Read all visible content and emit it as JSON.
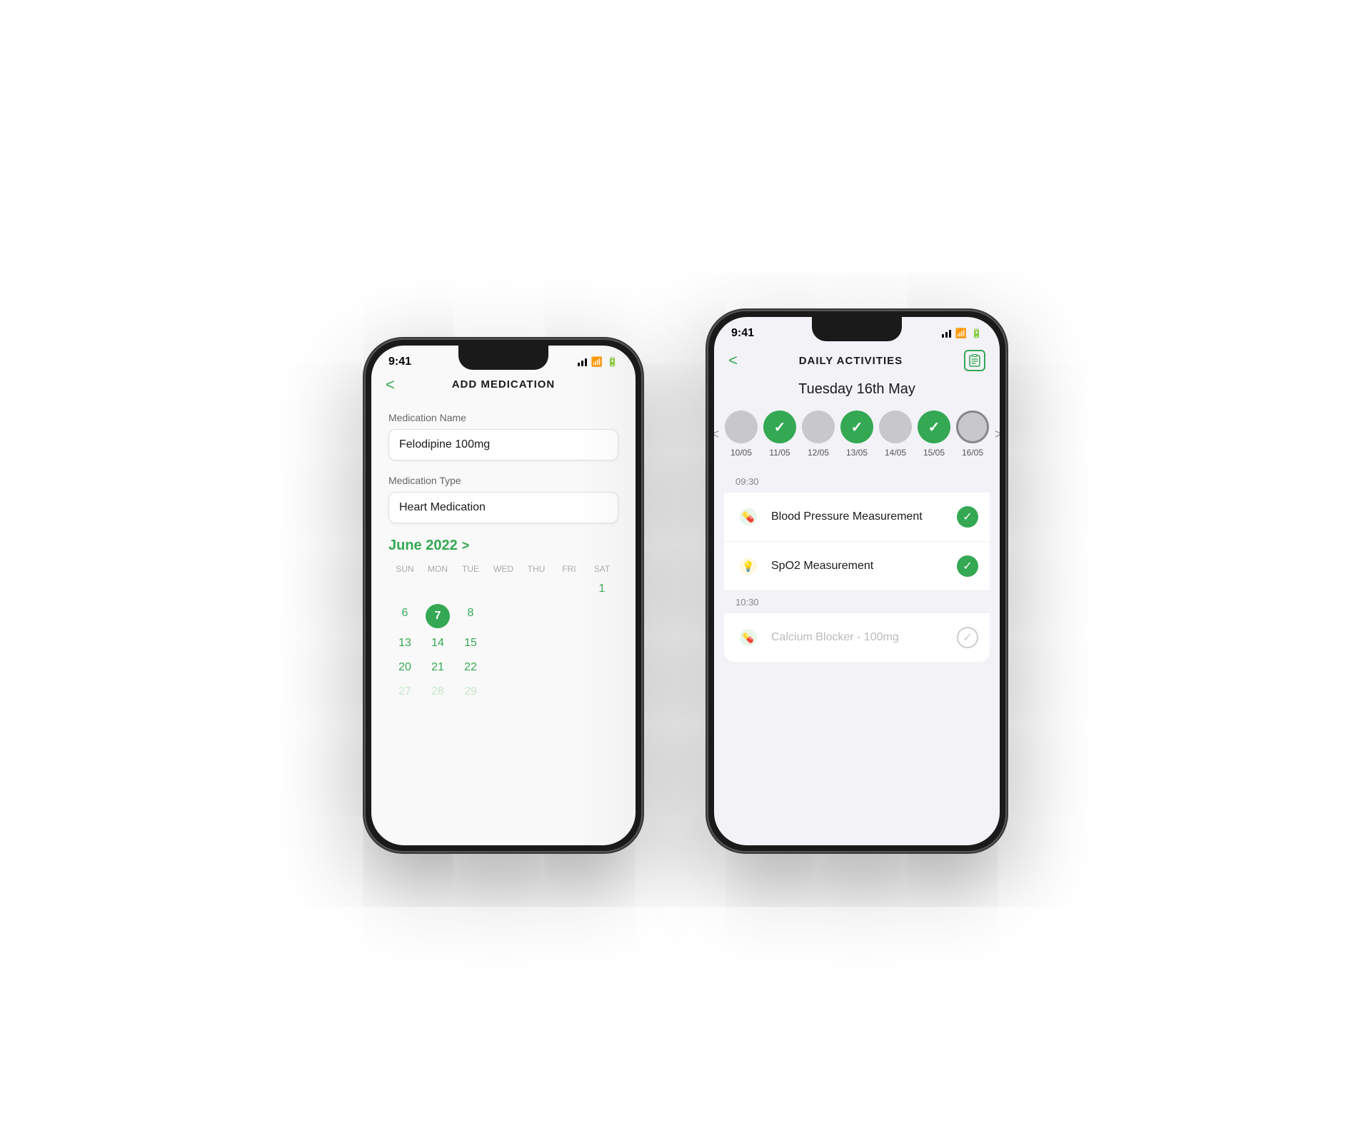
{
  "phone1": {
    "status": {
      "time": "9:41",
      "signal": [
        3,
        4,
        5
      ],
      "wifi": "wifi",
      "battery": "battery"
    },
    "nav": {
      "back": "<",
      "title": "ADD MEDICATION"
    },
    "form": {
      "name_label": "Medication Name",
      "name_value": "Felodipine 100mg",
      "type_label": "Medication Type",
      "type_value": "Heart Medication"
    },
    "calendar": {
      "month_label": "June 2022",
      "chevron": ">",
      "headers": [
        "SUN",
        "MON",
        "TUE",
        "WED",
        "THU",
        "FRI",
        "SAT"
      ],
      "days": [
        {
          "label": "",
          "state": "empty"
        },
        {
          "label": "",
          "state": "empty"
        },
        {
          "label": "",
          "state": "empty"
        },
        {
          "label": "",
          "state": "empty"
        },
        {
          "label": "",
          "state": "empty"
        },
        {
          "label": "",
          "state": "empty"
        },
        {
          "label": "1",
          "state": "normal"
        },
        {
          "label": "6",
          "state": "normal"
        },
        {
          "label": "7",
          "state": "today"
        },
        {
          "label": "8",
          "state": "normal"
        },
        {
          "label": "",
          "state": "empty"
        },
        {
          "label": "",
          "state": "empty"
        },
        {
          "label": "",
          "state": "empty"
        },
        {
          "label": "",
          "state": "empty"
        },
        {
          "label": "13",
          "state": "normal"
        },
        {
          "label": "14",
          "state": "normal"
        },
        {
          "label": "15",
          "state": "normal"
        },
        {
          "label": "",
          "state": "empty"
        },
        {
          "label": "",
          "state": "empty"
        },
        {
          "label": "",
          "state": "empty"
        },
        {
          "label": "",
          "state": "empty"
        },
        {
          "label": "20",
          "state": "normal"
        },
        {
          "label": "21",
          "state": "normal"
        },
        {
          "label": "22",
          "state": "normal"
        },
        {
          "label": "",
          "state": "empty"
        },
        {
          "label": "",
          "state": "empty"
        },
        {
          "label": "",
          "state": "empty"
        },
        {
          "label": "",
          "state": "empty"
        },
        {
          "label": "27",
          "state": "faded"
        },
        {
          "label": "28",
          "state": "faded"
        },
        {
          "label": "29",
          "state": "faded"
        }
      ]
    }
  },
  "phone2": {
    "status": {
      "time": "9:41",
      "signal": [
        3,
        4,
        5
      ],
      "wifi": "wifi",
      "battery": "battery"
    },
    "nav": {
      "back": "<",
      "title": "DAILY ACTIVITIES",
      "icon": "📋"
    },
    "date_title": "Tuesday 16th May",
    "day_strip": {
      "prev": "<",
      "next": ">",
      "days": [
        {
          "label": "10/05",
          "checked": false
        },
        {
          "label": "11/05",
          "checked": true
        },
        {
          "label": "12/05",
          "checked": false
        },
        {
          "label": "13/05",
          "checked": true
        },
        {
          "label": "14/05",
          "checked": false
        },
        {
          "label": "15/05",
          "checked": true
        },
        {
          "label": "16/05",
          "checked": false,
          "active": true
        }
      ]
    },
    "time_slots": [
      {
        "time": "09:30",
        "activities": [
          {
            "icon": "💊",
            "name": "Blood Pressure Measurement",
            "checked": true,
            "faded": false
          },
          {
            "icon": "💡",
            "name": "SpO2 Measurement",
            "checked": true,
            "faded": false
          }
        ]
      },
      {
        "time": "10:30",
        "activities": [
          {
            "icon": "💊",
            "name": "Calcium Blocker - 100mg",
            "checked": true,
            "faded": true
          }
        ]
      }
    ]
  }
}
